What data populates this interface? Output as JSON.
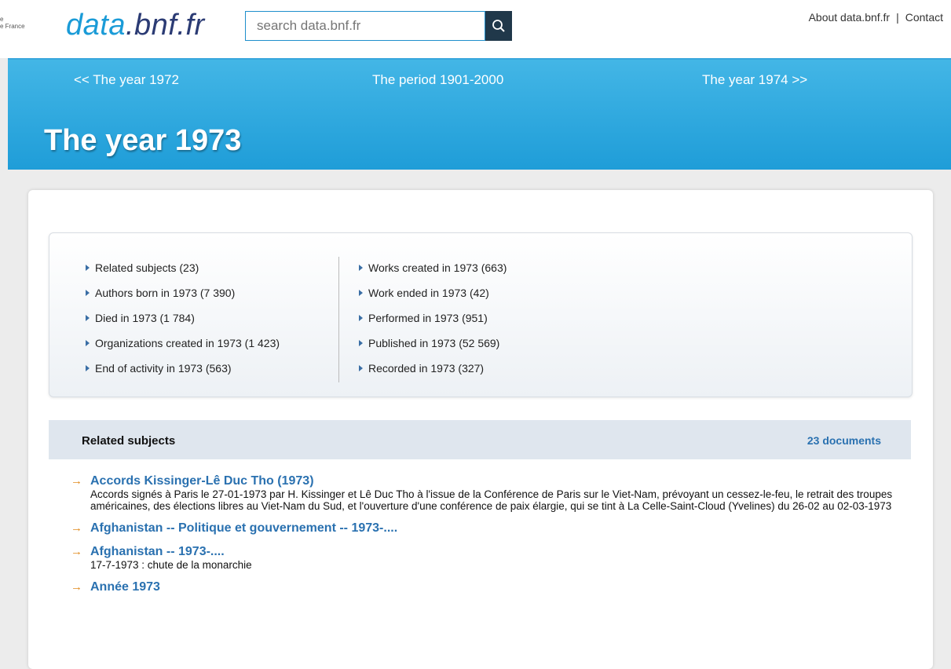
{
  "header": {
    "bnf_mark_lines": [
      "e",
      "e France"
    ],
    "logo_part1": "data",
    "logo_part2": ".bnf.fr",
    "search_placeholder": "search data.bnf.fr",
    "about_link": "About data.bnf.fr",
    "separator": "|",
    "contact_link": "Contact"
  },
  "banner": {
    "prev": "<< The year 1972",
    "period": "The period 1901-2000",
    "next": "The year 1974 >>",
    "title": "The year 1973"
  },
  "toc": {
    "left": [
      "Related subjects (23)",
      "Authors born in 1973 (7 390)",
      "Died in 1973 (1 784)",
      "Organizations created in 1973 (1 423)",
      "End of activity in 1973 (563)"
    ],
    "right": [
      "Works created in 1973 (663)",
      "Work ended in 1973 (42)",
      "Performed in 1973 (951)",
      "Published in 1973 (52 569)",
      "Recorded in 1973 (327)"
    ]
  },
  "section": {
    "title": "Related subjects",
    "count": "23 documents"
  },
  "subjects": [
    {
      "arrow": "→",
      "title": "Accords Kissinger-Lê Duc Tho (1973)",
      "desc": "Accords signés à Paris le 27-01-1973 par H. Kissinger et Lê Duc Tho à l'issue de la Conférence de Paris sur le Viet-Nam, prévoyant un cessez-le-feu, le retrait des troupes américaines, des élections libres au Viet-Nam du Sud, et l'ouverture d'une conférence de paix élargie, qui se tint à La Celle-Saint-Cloud (Yvelines) du 26-02 au 02-03-1973"
    },
    {
      "arrow": "→",
      "title": "Afghanistan -- Politique et gouvernement -- 1973-....",
      "desc": ""
    },
    {
      "arrow": "→",
      "title": "Afghanistan -- 1973-....",
      "desc": "17-7-1973 : chute de la monarchie"
    },
    {
      "arrow": "→",
      "title": "Année 1973",
      "desc": ""
    }
  ]
}
